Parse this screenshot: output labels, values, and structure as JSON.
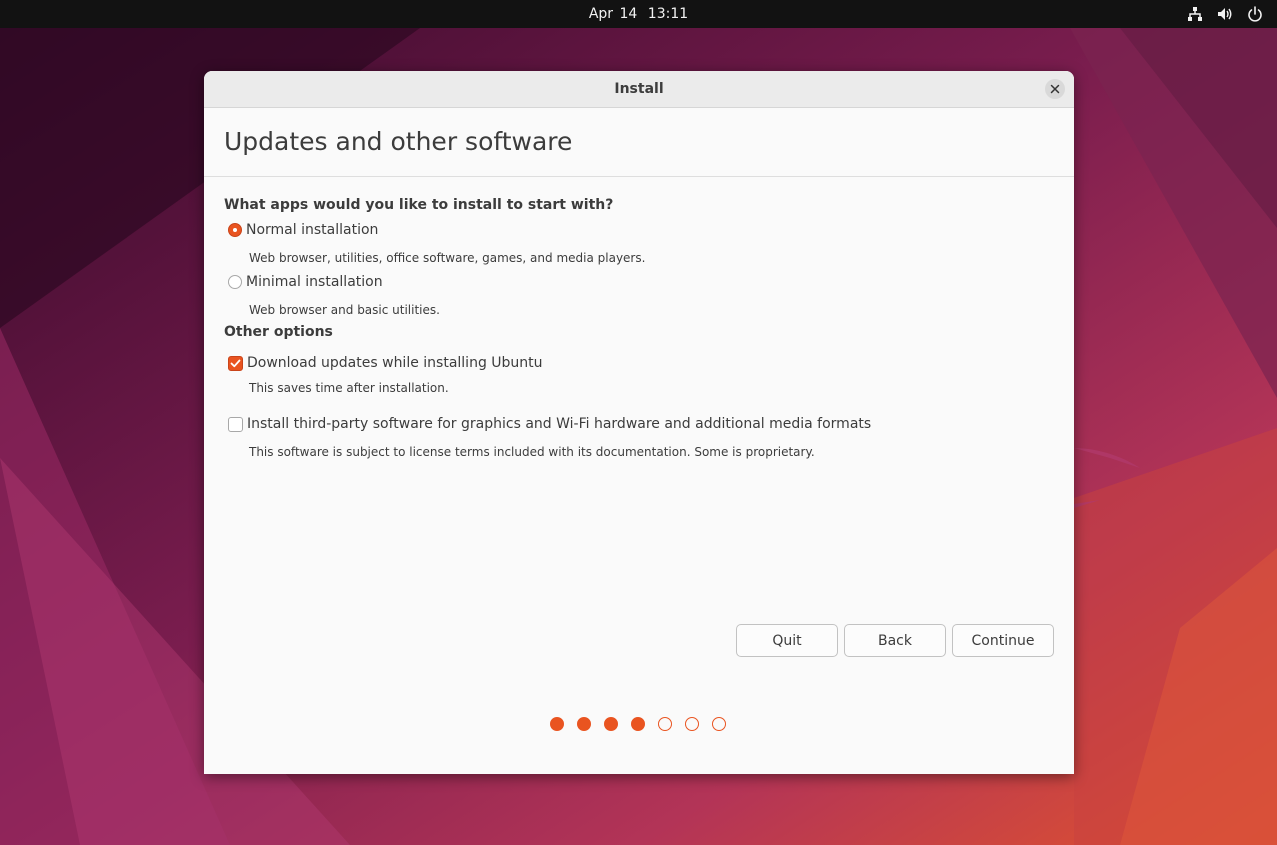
{
  "topbar": {
    "date": "Apr 14",
    "time": "13:11",
    "icons": [
      "network-icon",
      "volume-icon",
      "power-icon"
    ]
  },
  "window": {
    "title": "Install",
    "page_title": "Updates and other software"
  },
  "apps_section": {
    "label": "What apps would you like to install to start with?",
    "options": [
      {
        "label": "Normal installation",
        "description": "Web browser, utilities, office software, games, and media players.",
        "selected": true
      },
      {
        "label": "Minimal installation",
        "description": "Web browser and basic utilities.",
        "selected": false
      }
    ]
  },
  "other_section": {
    "label": "Other options",
    "options": [
      {
        "label": "Download updates while installing Ubuntu",
        "description": "This saves time after installation.",
        "checked": true
      },
      {
        "label": "Install third-party software for graphics and Wi-Fi hardware and additional media formats",
        "description": "This software is subject to license terms included with its documentation. Some is proprietary.",
        "checked": false
      }
    ]
  },
  "buttons": {
    "quit": "Quit",
    "back": "Back",
    "continue": "Continue"
  },
  "progress": {
    "total_steps": 7,
    "completed_steps": 4
  },
  "colors": {
    "accent": "#e95420",
    "topbar": "#121212"
  }
}
